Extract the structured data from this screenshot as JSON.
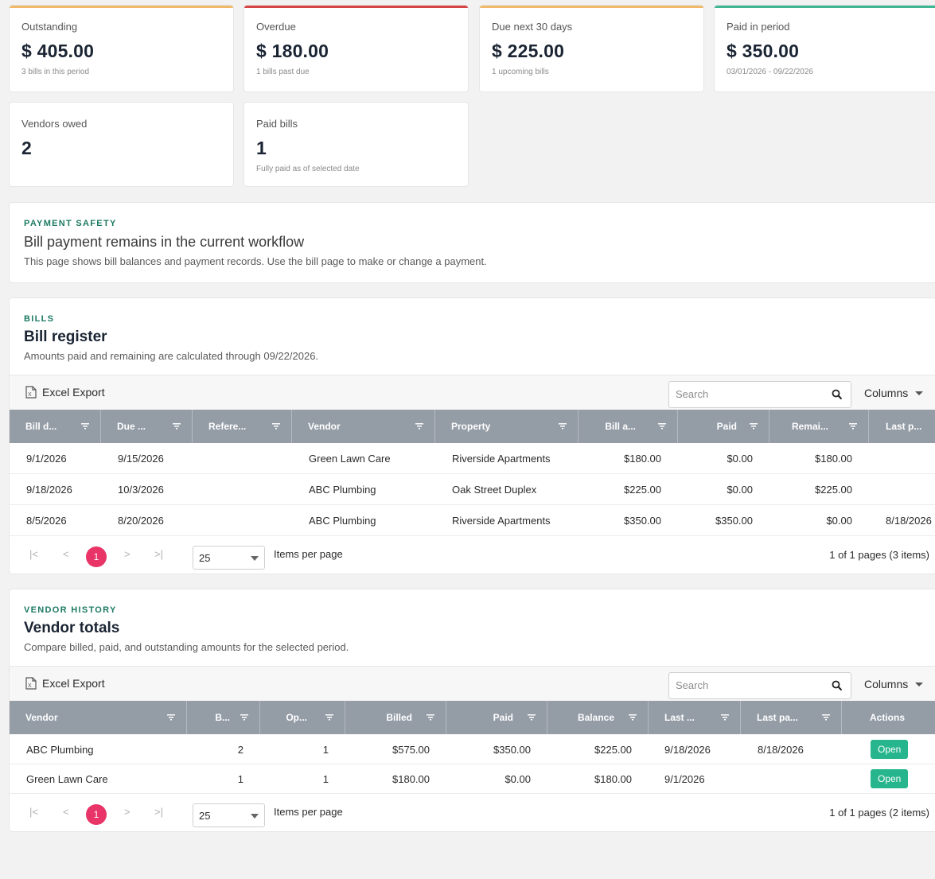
{
  "kpis": [
    {
      "label": "Outstanding",
      "value": "$ 405.00",
      "sub": "3 bills in this period",
      "accent": "#f0b86a"
    },
    {
      "label": "Overdue",
      "value": "$ 180.00",
      "sub": "1 bills past due",
      "accent": "#d64545"
    },
    {
      "label": "Due next 30 days",
      "value": "$ 225.00",
      "sub": "1 upcoming bills",
      "accent": "#f0b86a"
    },
    {
      "label": "Paid in period",
      "value": "$ 350.00",
      "sub": "03/01/2026 - 09/22/2026",
      "accent": "#3fb692"
    },
    {
      "label": "Vendors owed",
      "value": "2",
      "sub": ""
    },
    {
      "label": "Paid bills",
      "value": "1",
      "sub": "Fully paid as of selected date"
    }
  ],
  "safety": {
    "eyebrow": "PAYMENT SAFETY",
    "title": "Bill payment remains in the current workflow",
    "desc": "This page shows bill balances and payment records. Use the bill page to make or change a payment."
  },
  "bills": {
    "eyebrow": "BILLS",
    "title": "Bill register",
    "desc": "Amounts paid and remaining are calculated through 09/22/2026.",
    "export_label": "Excel Export",
    "search_placeholder": "Search",
    "columns_label": "Columns",
    "headers": [
      "Bill d...",
      "Due ...",
      "Refere...",
      "Vendor",
      "Property",
      "Bill a...",
      "Paid",
      "Remai...",
      "Last p..."
    ],
    "rows": [
      [
        "9/1/2026",
        "9/15/2026",
        "",
        "Green Lawn Care",
        "Riverside Apartments",
        "$180.00",
        "$0.00",
        "$180.00",
        ""
      ],
      [
        "9/18/2026",
        "10/3/2026",
        "",
        "ABC Plumbing",
        "Oak Street Duplex",
        "$225.00",
        "$0.00",
        "$225.00",
        ""
      ],
      [
        "8/5/2026",
        "8/20/2026",
        "",
        "ABC Plumbing",
        "Riverside Apartments",
        "$350.00",
        "$350.00",
        "$0.00",
        "8/18/2026"
      ]
    ],
    "pager": {
      "current": "1",
      "per_page": "25",
      "per_page_label": "Items per page",
      "info": "1 of 1 pages (3 items)"
    }
  },
  "vendors": {
    "eyebrow": "VENDOR HISTORY",
    "title": "Vendor totals",
    "desc": "Compare billed, paid, and outstanding amounts for the selected period.",
    "export_label": "Excel Export",
    "search_placeholder": "Search",
    "columns_label": "Columns",
    "headers": [
      "Vendor",
      "B...",
      "Op...",
      "Billed",
      "Paid",
      "Balance",
      "Last ...",
      "Last pa...",
      "Actions"
    ],
    "rows": [
      [
        "ABC Plumbing",
        "2",
        "1",
        "$575.00",
        "$350.00",
        "$225.00",
        "9/18/2026",
        "8/18/2026",
        "Open"
      ],
      [
        "Green Lawn Care",
        "1",
        "1",
        "$180.00",
        "$0.00",
        "$180.00",
        "9/1/2026",
        "",
        "Open"
      ]
    ],
    "pager": {
      "current": "1",
      "per_page": "25",
      "per_page_label": "Items per page",
      "info": "1 of 1 pages (2 items)"
    }
  }
}
